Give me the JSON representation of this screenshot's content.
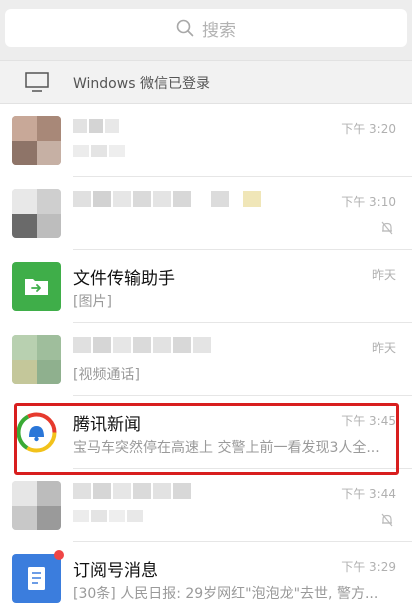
{
  "search": {
    "placeholder": "搜索"
  },
  "login_banner": {
    "text": "Windows 微信已登录"
  },
  "chats": [
    {
      "name": "",
      "preview": "",
      "time": "下午 3:20",
      "muted": false,
      "blurred": true
    },
    {
      "name": "",
      "preview": "",
      "time": "下午 3:10",
      "muted": true,
      "blurred": true
    },
    {
      "name": "文件传输助手",
      "preview": "[图片]",
      "time": "昨天",
      "muted": false,
      "blurred": false
    },
    {
      "name": "",
      "preview": "[视频通话]",
      "time": "昨天",
      "muted": false,
      "blurred": true
    },
    {
      "name": "腾讯新闻",
      "preview": "宝马车突然停在高速上 交警上前一看发现3人全...",
      "time": "下午 3:45",
      "muted": false,
      "blurred": false
    },
    {
      "name": "",
      "preview": "",
      "time": "下午 3:44",
      "muted": true,
      "blurred": true
    },
    {
      "name": "订阅号消息",
      "preview": "[30条] 人民日报: 29岁网红\"泡泡龙\"去世, 警方...",
      "time": "下午 3:29",
      "muted": false,
      "blurred": false,
      "unread_dot": true
    }
  ],
  "colors": {
    "highlight": "#d81e1e",
    "file_helper_green": "#3fae49",
    "subscription_blue": "#3b7ddd"
  }
}
